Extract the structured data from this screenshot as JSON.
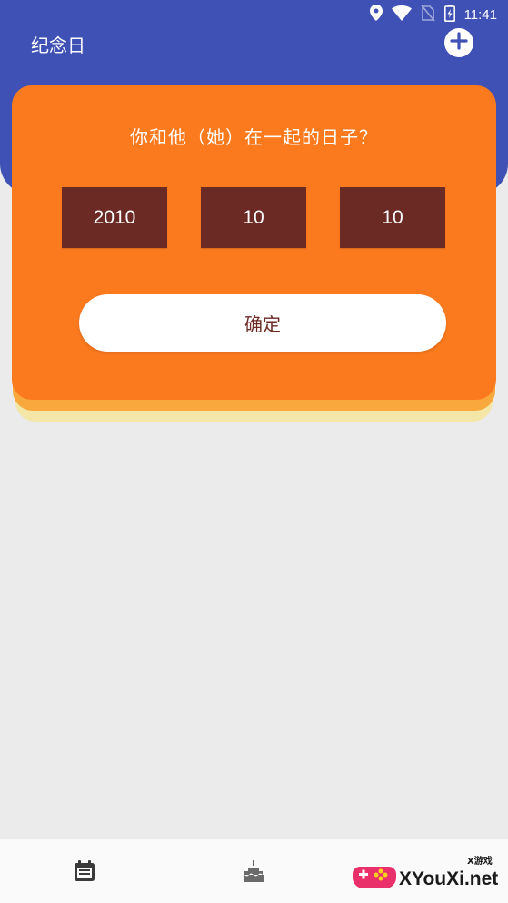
{
  "status_bar": {
    "time": "11:41",
    "icons": [
      "location-icon",
      "wifi-icon",
      "no-sim-icon",
      "battery-icon"
    ]
  },
  "header": {
    "title": "纪念日",
    "add_icon": "plus-circle-icon"
  },
  "card": {
    "question": "你和他（她）在一起的日子？",
    "year": "2010",
    "month": "10",
    "day": "10",
    "confirm_label": "确定"
  },
  "bottom_nav": {
    "items": [
      {
        "icon": "calendar-icon"
      },
      {
        "icon": "cake-icon"
      },
      {
        "icon": "more-icon"
      }
    ]
  },
  "watermark": {
    "text": "XYouXi.net",
    "small_text": "X游戏"
  },
  "colors": {
    "header": "#3f51b5",
    "card": "#fc7a1e",
    "date_box": "#6b2a24",
    "background": "#ebebeb"
  }
}
